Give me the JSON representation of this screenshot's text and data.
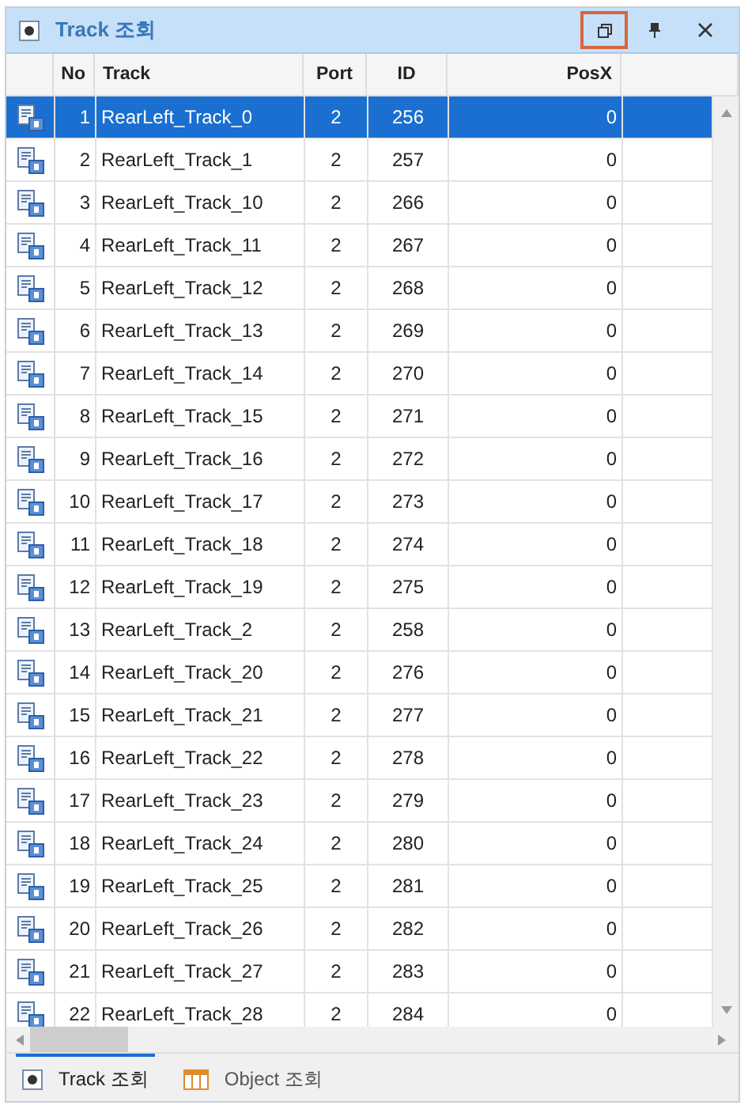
{
  "panel": {
    "title": "Track 조회",
    "buttons": [
      {
        "kind": "restore",
        "highlighted": true
      },
      {
        "kind": "pin",
        "highlighted": false
      },
      {
        "kind": "close",
        "highlighted": false
      }
    ]
  },
  "table": {
    "columns": [
      "No",
      "Track",
      "Port",
      "ID",
      "PosX"
    ],
    "rows": [
      {
        "no": "1",
        "track": "RearLeft_Track_0",
        "port": "2",
        "id": "256",
        "posx": "0",
        "selected": true
      },
      {
        "no": "2",
        "track": "RearLeft_Track_1",
        "port": "2",
        "id": "257",
        "posx": "0",
        "selected": false
      },
      {
        "no": "3",
        "track": "RearLeft_Track_10",
        "port": "2",
        "id": "266",
        "posx": "0",
        "selected": false
      },
      {
        "no": "4",
        "track": "RearLeft_Track_11",
        "port": "2",
        "id": "267",
        "posx": "0",
        "selected": false
      },
      {
        "no": "5",
        "track": "RearLeft_Track_12",
        "port": "2",
        "id": "268",
        "posx": "0",
        "selected": false
      },
      {
        "no": "6",
        "track": "RearLeft_Track_13",
        "port": "2",
        "id": "269",
        "posx": "0",
        "selected": false
      },
      {
        "no": "7",
        "track": "RearLeft_Track_14",
        "port": "2",
        "id": "270",
        "posx": "0",
        "selected": false
      },
      {
        "no": "8",
        "track": "RearLeft_Track_15",
        "port": "2",
        "id": "271",
        "posx": "0",
        "selected": false
      },
      {
        "no": "9",
        "track": "RearLeft_Track_16",
        "port": "2",
        "id": "272",
        "posx": "0",
        "selected": false
      },
      {
        "no": "10",
        "track": "RearLeft_Track_17",
        "port": "2",
        "id": "273",
        "posx": "0",
        "selected": false
      },
      {
        "no": "11",
        "track": "RearLeft_Track_18",
        "port": "2",
        "id": "274",
        "posx": "0",
        "selected": false
      },
      {
        "no": "12",
        "track": "RearLeft_Track_19",
        "port": "2",
        "id": "275",
        "posx": "0",
        "selected": false
      },
      {
        "no": "13",
        "track": "RearLeft_Track_2",
        "port": "2",
        "id": "258",
        "posx": "0",
        "selected": false
      },
      {
        "no": "14",
        "track": "RearLeft_Track_20",
        "port": "2",
        "id": "276",
        "posx": "0",
        "selected": false
      },
      {
        "no": "15",
        "track": "RearLeft_Track_21",
        "port": "2",
        "id": "277",
        "posx": "0",
        "selected": false
      },
      {
        "no": "16",
        "track": "RearLeft_Track_22",
        "port": "2",
        "id": "278",
        "posx": "0",
        "selected": false
      },
      {
        "no": "17",
        "track": "RearLeft_Track_23",
        "port": "2",
        "id": "279",
        "posx": "0",
        "selected": false
      },
      {
        "no": "18",
        "track": "RearLeft_Track_24",
        "port": "2",
        "id": "280",
        "posx": "0",
        "selected": false
      },
      {
        "no": "19",
        "track": "RearLeft_Track_25",
        "port": "2",
        "id": "281",
        "posx": "0",
        "selected": false
      },
      {
        "no": "20",
        "track": "RearLeft_Track_26",
        "port": "2",
        "id": "282",
        "posx": "0",
        "selected": false
      },
      {
        "no": "21",
        "track": "RearLeft_Track_27",
        "port": "2",
        "id": "283",
        "posx": "0",
        "selected": false
      },
      {
        "no": "22",
        "track": "RearLeft_Track_28",
        "port": "2",
        "id": "284",
        "posx": "0",
        "selected": false
      }
    ]
  },
  "bottom_tabs": [
    {
      "label": "Track 조회",
      "kind": "track",
      "selected": true
    },
    {
      "label": "Object 조회",
      "kind": "object",
      "selected": false
    }
  ]
}
